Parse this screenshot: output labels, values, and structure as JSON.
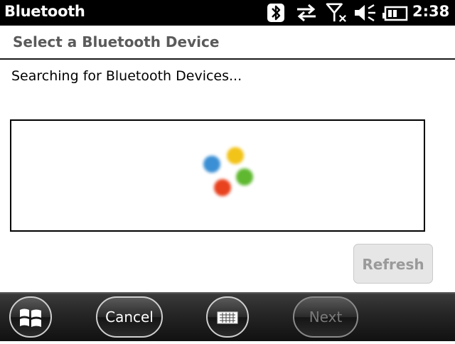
{
  "titlebar": {
    "app_title": "Bluetooth",
    "clock": "2:38",
    "icons": [
      "bluetooth-icon",
      "data-connection-icon",
      "no-signal-icon",
      "speaker-icon",
      "battery-icon"
    ]
  },
  "header": {
    "title": "Select a Bluetooth Device"
  },
  "main": {
    "status_text": "Searching for Bluetooth Devices...",
    "spinner_colors": [
      "#3b8fd4",
      "#f2c318",
      "#e8421f",
      "#5fb830"
    ],
    "refresh_label": "Refresh"
  },
  "softkeys": {
    "start_icon": "windows-logo-icon",
    "cancel_label": "Cancel",
    "keyboard_icon": "keyboard-icon",
    "next_label": "Next"
  }
}
